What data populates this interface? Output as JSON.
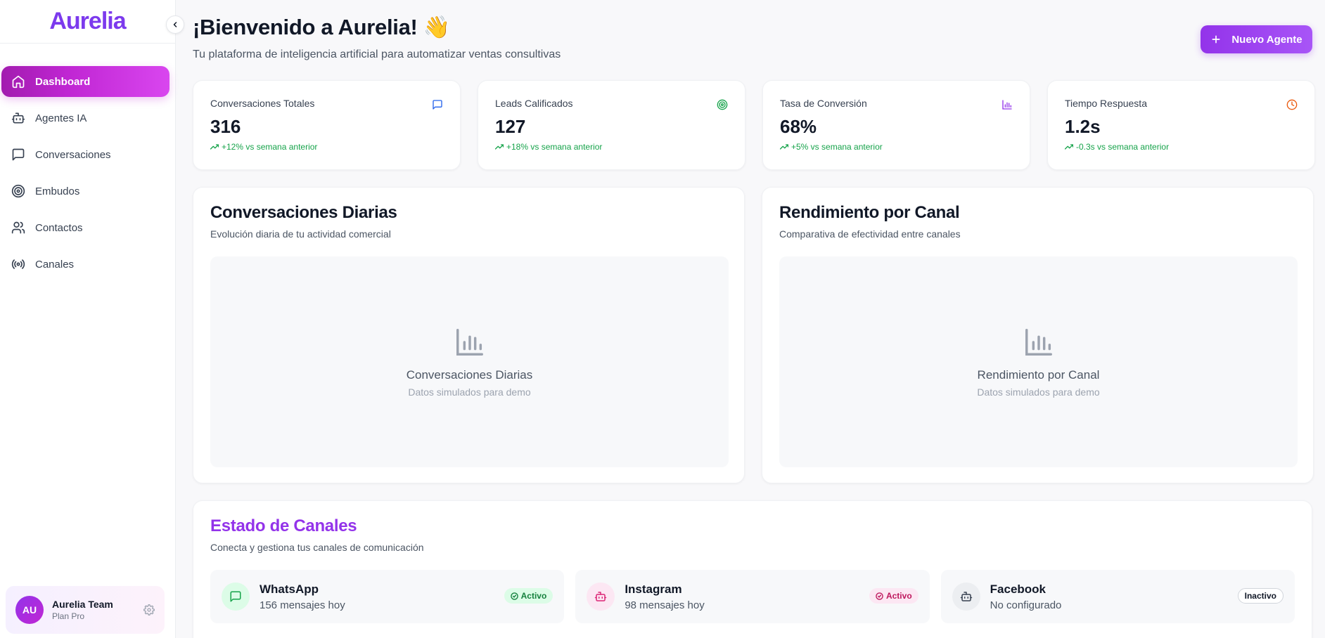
{
  "sidebar": {
    "brand": "Aurelia",
    "items": [
      {
        "label": "Dashboard",
        "icon": "home-icon"
      },
      {
        "label": "Agentes IA",
        "icon": "bot-icon"
      },
      {
        "label": "Conversaciones",
        "icon": "message-icon"
      },
      {
        "label": "Embudos",
        "icon": "target-icon"
      },
      {
        "label": "Contactos",
        "icon": "users-icon"
      },
      {
        "label": "Canales",
        "icon": "radio-icon"
      }
    ],
    "user": {
      "initials": "AU",
      "name": "Aurelia Team",
      "plan": "Plan Pro"
    }
  },
  "header": {
    "title": "¡Bienvenido a Aurelia! 👋",
    "subtitle": "Tu plataforma de inteligencia artificial para automatizar ventas consultivas",
    "new_agent_label": "Nuevo Agente"
  },
  "stats": [
    {
      "label": "Conversaciones Totales",
      "value": "316",
      "change": "+12% vs semana anterior",
      "icon": "message-icon",
      "color": "#2563eb"
    },
    {
      "label": "Leads Calificados",
      "value": "127",
      "change": "+18% vs semana anterior",
      "icon": "target-icon",
      "color": "#16a34a"
    },
    {
      "label": "Tasa de Conversión",
      "value": "68%",
      "change": "+5% vs semana anterior",
      "icon": "bar-chart-icon",
      "color": "#9333ea"
    },
    {
      "label": "Tiempo Respuesta",
      "value": "1.2s",
      "change": "-0.3s vs semana anterior",
      "icon": "clock-icon",
      "color": "#ea580c"
    }
  ],
  "panels": [
    {
      "title": "Conversaciones Diarias",
      "subtitle": "Evolución diaria de tu actividad comercial",
      "placeholder_title": "Conversaciones Diarias",
      "placeholder_sub": "Datos simulados para demo"
    },
    {
      "title": "Rendimiento por Canal",
      "subtitle": "Comparativa de efectividad entre canales",
      "placeholder_title": "Rendimiento por Canal",
      "placeholder_sub": "Datos simulados para demo"
    }
  ],
  "channels": {
    "title": "Estado de Canales",
    "subtitle": "Conecta y gestiona tus canales de comunicación",
    "items": [
      {
        "name": "WhatsApp",
        "detail": "156 mensajes hoy",
        "status": "Activo",
        "icon": "message-icon"
      },
      {
        "name": "Instagram",
        "detail": "98 mensajes hoy",
        "status": "Activo",
        "icon": "bot-icon"
      },
      {
        "name": "Facebook",
        "detail": "No configurado",
        "status": "Inactivo",
        "icon": "bot-icon"
      }
    ]
  },
  "colors": {
    "brand": "#7c3aed",
    "accent": "#c026d3",
    "success": "#16a34a"
  }
}
